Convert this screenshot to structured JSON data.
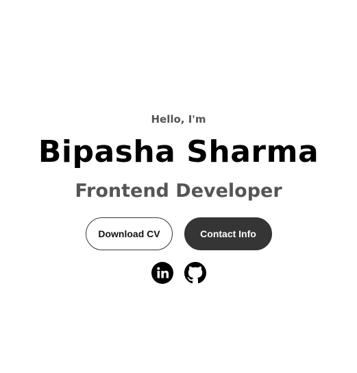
{
  "hero": {
    "greeting": "Hello, I'm",
    "name": "Bipasha Sharma",
    "role": "Frontend Developer"
  },
  "buttons": {
    "download_label": "Download CV",
    "contact_label": "Contact Info"
  },
  "social": [
    {
      "icon": "linkedin-icon"
    },
    {
      "icon": "github-icon"
    }
  ],
  "colors": {
    "background": "#ffffff",
    "name_text": "#000000",
    "secondary_text": "#555555",
    "button_dark": "#353535",
    "button_dark_text": "#ffffff"
  }
}
